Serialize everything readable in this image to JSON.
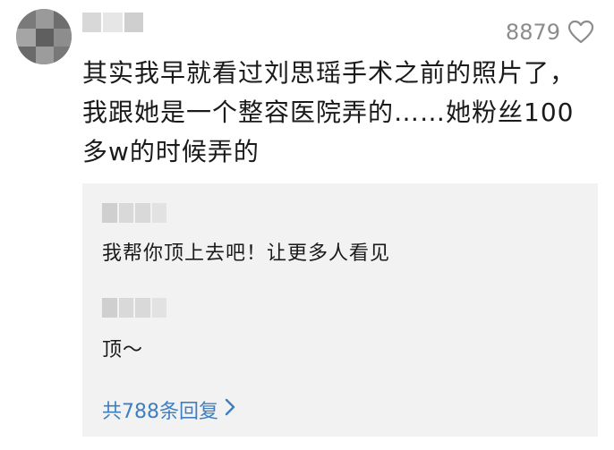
{
  "comment": {
    "like_count": "8879",
    "like_icon": "heart-outline-icon",
    "text": "其实我早就看过刘思瑶手术之前的照片了，我跟她是一个整容医院弄的……她粉丝100多w的时候弄的"
  },
  "replies": [
    {
      "text": "我帮你顶上去吧！让更多人看见"
    },
    {
      "text": "顶～"
    }
  ],
  "more_replies": {
    "label": "共788条回复",
    "icon": "chevron-right-icon"
  },
  "colors": {
    "link": "#3e7fc1",
    "muted": "#8c8c8c",
    "reply_bg": "#f2f2f2"
  }
}
